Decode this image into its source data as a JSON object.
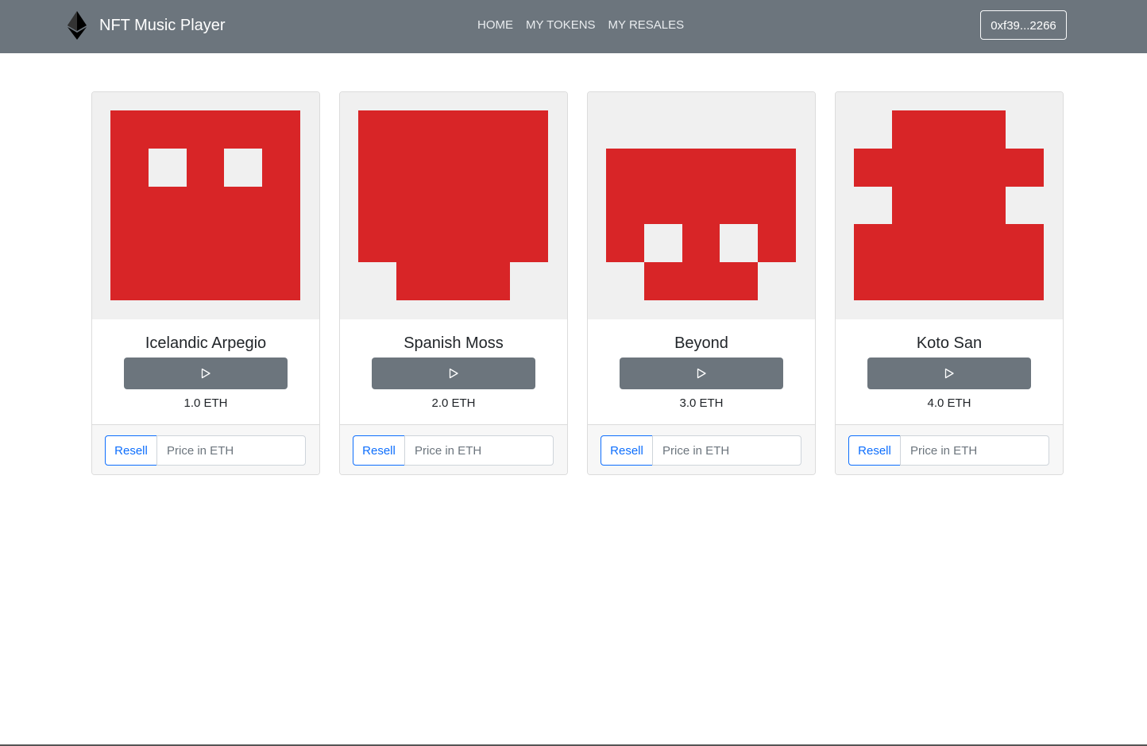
{
  "app": {
    "brand": "NFT Music Player",
    "brand_icon": "ethereum-icon"
  },
  "nav": {
    "items": [
      {
        "label": "HOME"
      },
      {
        "label": "MY TOKENS"
      },
      {
        "label": "MY RESALES"
      }
    ]
  },
  "account": {
    "label": "0xf39...2266"
  },
  "colors": {
    "navbar": "#6c757d",
    "art_red": "#d82527",
    "art_bg": "#f0f0f0",
    "play_button": "#6c757d",
    "resell_accent": "#0d6efd"
  },
  "cards": [
    {
      "title": "Icelandic Arpegio",
      "price": "1.0 ETH",
      "play_icon": "play-icon",
      "resell_label": "Resell",
      "price_placeholder": "Price in ETH"
    },
    {
      "title": "Spanish Moss",
      "price": "2.0 ETH",
      "play_icon": "play-icon",
      "resell_label": "Resell",
      "price_placeholder": "Price in ETH"
    },
    {
      "title": "Beyond",
      "price": "3.0 ETH",
      "play_icon": "play-icon",
      "resell_label": "Resell",
      "price_placeholder": "Price in ETH"
    },
    {
      "title": "Koto San",
      "price": "4.0 ETH",
      "play_icon": "play-icon",
      "resell_label": "Resell",
      "price_placeholder": "Price in ETH"
    }
  ]
}
